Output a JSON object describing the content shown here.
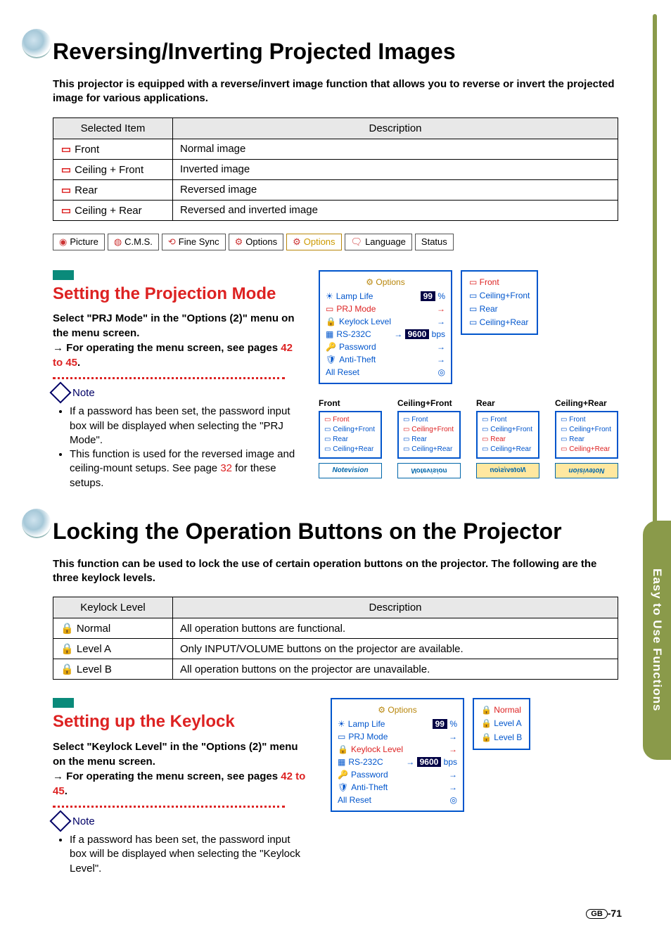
{
  "sideTab": "Easy to Use Functions",
  "sec1": {
    "title": "Reversing/Inverting Projected Images",
    "intro": "This projector is equipped with a reverse/invert image function that allows you to reverse or invert the projected image for various applications.",
    "tbl": {
      "h1": "Selected Item",
      "h2": "Description",
      "rows": [
        {
          "item": "Front",
          "desc": "Normal image"
        },
        {
          "item": "Ceiling + Front",
          "desc": "Inverted image"
        },
        {
          "item": "Rear",
          "desc": "Reversed image"
        },
        {
          "item": "Ceiling + Rear",
          "desc": "Reversed and inverted image"
        }
      ]
    }
  },
  "menuTabs": [
    "Picture",
    "C.M.S.",
    "Fine Sync",
    "Options",
    "Options",
    "Language",
    "Status"
  ],
  "sec1a": {
    "h2": "Setting the Projection Mode",
    "body1": "Select \"PRJ Mode\" in the \"Options (2)\" menu on the menu screen.",
    "body2a": "→ For operating the menu screen, see pages ",
    "body2b": "42 to 45",
    "body2c": ".",
    "noteLabel": "Note",
    "notes": [
      "If a password has been set, the password input box will be displayed when selecting the \"PRJ Mode\".",
      "This function is used for the reversed image and ceiling-mount setups. See page 32 for these setups."
    ]
  },
  "osd1": {
    "title": "Options",
    "rows": [
      {
        "label": "Lamp Life",
        "val": "99",
        "suffix": "%",
        "hl": false
      },
      {
        "label": "PRJ Mode",
        "arrow": "→",
        "hl": true
      },
      {
        "label": "Keylock Level",
        "arrow": "→",
        "hl": false
      },
      {
        "label": "RS-232C",
        "arrow": "→",
        "val": "9600",
        "suffix": "bps",
        "hl": false
      },
      {
        "label": "Password",
        "arrow": "→",
        "hl": false
      },
      {
        "label": "Anti-Theft",
        "arrow": "→",
        "hl": false
      },
      {
        "label": "All Reset",
        "hl": false
      }
    ],
    "sub": [
      "Front",
      "Ceiling+Front",
      "Rear",
      "Ceiling+Rear"
    ],
    "subHl": 0
  },
  "quad": {
    "heads": [
      "Front",
      "Ceiling+Front",
      "Rear",
      "Ceiling+Rear"
    ],
    "items": [
      "Front",
      "Ceiling+Front",
      "Rear",
      "Ceiling+Rear"
    ],
    "logo": "Notevision"
  },
  "sec2": {
    "title": "Locking the Operation Buttons on the Projector",
    "intro": "This function can be used to lock the use of certain operation buttons on the projector. The following are the three keylock levels.",
    "tbl": {
      "h1": "Keylock Level",
      "h2": "Description",
      "rows": [
        {
          "item": "Normal",
          "desc": "All operation buttons are functional."
        },
        {
          "item": "Level A",
          "desc": "Only INPUT/VOLUME buttons on the projector are available."
        },
        {
          "item": "Level B",
          "desc": "All operation buttons on the projector are unavailable."
        }
      ]
    }
  },
  "sec2a": {
    "h2": "Setting up the Keylock",
    "body1": "Select \"Keylock Level\" in the \"Options (2)\" menu on the menu screen.",
    "body2a": "→ For operating the menu screen, see pages ",
    "body2b": "42 to 45",
    "body2c": ".",
    "noteLabel": "Note",
    "notes": [
      "If a password has been set, the password input box will be displayed when selecting the \"Keylock Level\"."
    ]
  },
  "osd2": {
    "title": "Options",
    "rows": [
      {
        "label": "Lamp Life",
        "val": "99",
        "suffix": "%",
        "hl": false
      },
      {
        "label": "PRJ Mode",
        "arrow": "→",
        "hl": false
      },
      {
        "label": "Keylock Level",
        "arrow": "→",
        "hl": true
      },
      {
        "label": "RS-232C",
        "arrow": "→",
        "val": "9600",
        "suffix": "bps",
        "hl": false
      },
      {
        "label": "Password",
        "arrow": "→",
        "hl": false
      },
      {
        "label": "Anti-Theft",
        "arrow": "→",
        "hl": false
      },
      {
        "label": "All Reset",
        "hl": false
      }
    ],
    "sub": [
      "Normal",
      "Level A",
      "Level B"
    ],
    "subHl": 0
  },
  "pageNum": "-71",
  "pageLang": "GB"
}
